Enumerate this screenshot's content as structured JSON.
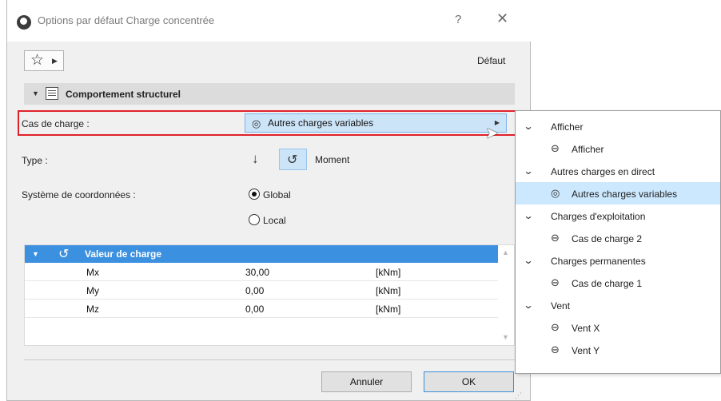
{
  "dialog": {
    "title": "Options par défaut Charge concentrée",
    "help_glyph": "?",
    "close_glyph": "✕",
    "default_label": "Défaut"
  },
  "section": {
    "title": "Comportement structurel"
  },
  "load_case": {
    "label": "Cas de charge :",
    "value": "Autres charges variables"
  },
  "type": {
    "label": "Type :",
    "selected": "Moment"
  },
  "coordinates": {
    "label": "Système de coordonnées :",
    "options": [
      "Global",
      "Local"
    ],
    "selected": "Global"
  },
  "load_table": {
    "header": "Valeur de charge",
    "rows": [
      {
        "name": "Mx",
        "value": "30,00",
        "unit": "[kNm]"
      },
      {
        "name": "My",
        "value": "0,00",
        "unit": "[kNm]"
      },
      {
        "name": "Mz",
        "value": "0,00",
        "unit": "[kNm]"
      }
    ]
  },
  "buttons": {
    "cancel": "Annuler",
    "ok": "OK"
  },
  "menu": {
    "groups": [
      {
        "label": "Afficher",
        "items": [
          "Afficher"
        ]
      },
      {
        "label": "Autres charges en direct",
        "items": [
          "Autres charges variables"
        ]
      },
      {
        "label": "Charges d'exploitation",
        "items": [
          "Cas de charge 2"
        ]
      },
      {
        "label": "Charges permanentes",
        "items": [
          "Cas de charge 1"
        ]
      },
      {
        "label": "Vent",
        "items": [
          "Vent X",
          "Vent Y"
        ]
      }
    ],
    "selected_item": "Autres charges variables"
  },
  "colors": {
    "selection": "#cce4f7",
    "table_header": "#3c90e0",
    "highlight_border": "#e0202a"
  }
}
